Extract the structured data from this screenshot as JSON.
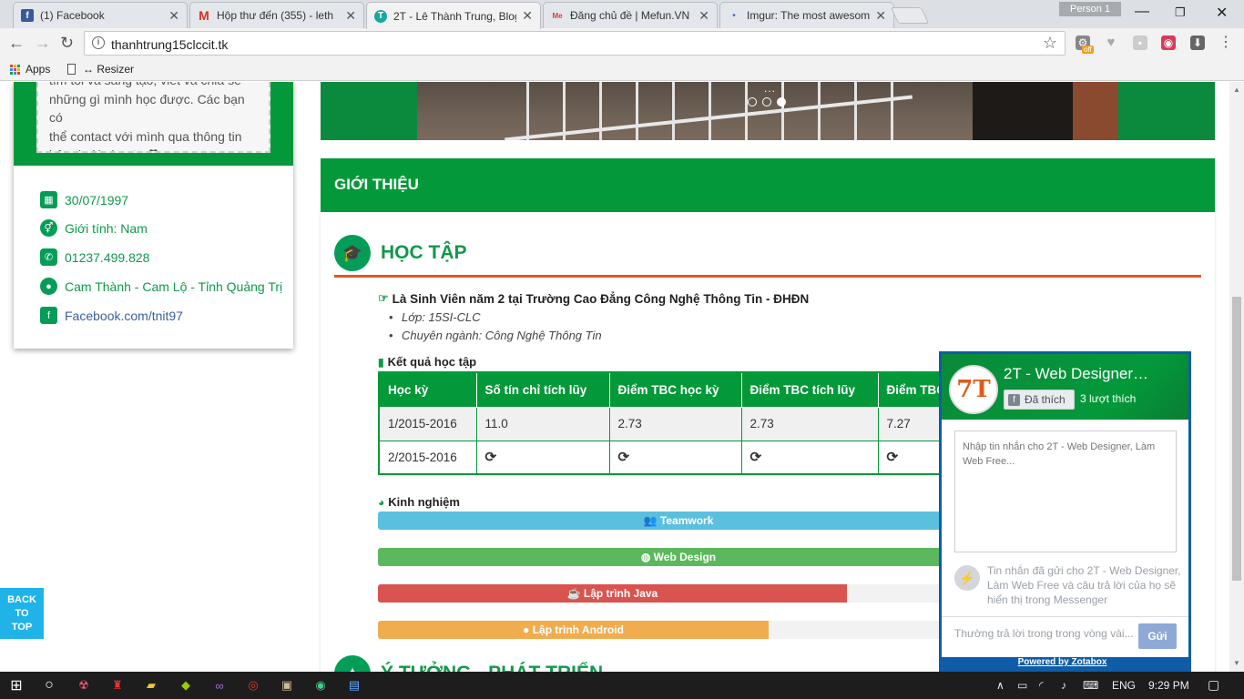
{
  "browser": {
    "tabs": [
      {
        "title": "(1) Facebook",
        "favicon": "facebook-icon",
        "color": "#3b5998"
      },
      {
        "title": "Hộp thư đến (355) - leth",
        "favicon": "gmail-icon",
        "color": "#d93025"
      },
      {
        "title": "2T - Lê Thành Trung, Blog",
        "favicon": "2t-site-icon",
        "color": "#1aa89e"
      },
      {
        "title": "Đăng chủ đề | Mefun.VN",
        "favicon": "mefun-icon",
        "color": "#e53935"
      },
      {
        "title": "Imgur: The most awesom",
        "favicon": "imgur-icon",
        "color": "#4a6fd0"
      }
    ],
    "person_label": "Person 1",
    "url": "thanhtrung15clccit.tk",
    "ext_badge": "off",
    "bookmarks": [
      {
        "label": "Apps"
      },
      {
        "label": "↔ Resizer"
      }
    ]
  },
  "sidebar": {
    "quote_lines": [
      "tìm tòi và sáng tạo, viết và chia sẻ",
      "những gì mình học được. Các bạn có",
      "thể contact với mình qua thông tin",
      "bên dưới nha 🗪 ❞"
    ],
    "contacts": [
      {
        "icon": "calendar-icon",
        "text": "30/07/1997"
      },
      {
        "icon": "gender-icon",
        "text": "Giới tính: Nam"
      },
      {
        "icon": "phone-icon",
        "text": "01237.499.828"
      },
      {
        "icon": "map-marker-icon",
        "text": "Cam Thành - Cam Lộ - Tỉnh Quảng Trị"
      },
      {
        "icon": "facebook-icon",
        "text": "Facebook.com/tnit97"
      }
    ]
  },
  "slider": {
    "active_dot": 3,
    "dot_count": 3,
    "ellipsis": "..."
  },
  "section": {
    "title": "GIỚI THIỆU",
    "hoc_tap": {
      "title": "HỌC TẬP",
      "headline": "Là Sinh Viên năm 2 tại Trường Cao Đẳng Công Nghệ Thông Tin - ĐHĐN",
      "bullets": [
        "Lớp: 15SI-CLC",
        "Chuyên ngành: Công Nghệ Thông Tin"
      ],
      "results_title": "Kết quả học tập",
      "table": {
        "headers": [
          "Học kỳ",
          "Số tín chỉ tích lũy",
          "Điểm TBC học kỳ",
          "Điểm TBC tích lũy",
          "Điểm TBC"
        ],
        "rows": [
          [
            "1/2015-2016",
            "11.0",
            "2.73",
            "2.73",
            "7.27"
          ],
          [
            "2/2015-2016",
            "⟳",
            "⟳",
            "⟳",
            "⟳"
          ]
        ]
      },
      "experience_title": "Kinh nghiệm",
      "skills": [
        {
          "label": "Teamwork",
          "icon": "users-icon",
          "level": 100,
          "color": "#5bc0de"
        },
        {
          "label": "Web Design",
          "icon": "globe-icon",
          "level": 100,
          "color": "#5cb85c"
        },
        {
          "label": "Lập trình Java",
          "icon": "java-icon",
          "level": 78,
          "color": "#d9534f"
        },
        {
          "label": "Lập trình Android",
          "icon": "android-icon",
          "level": 65,
          "color": "#f0ad4e"
        }
      ]
    },
    "next_title": "Ý TƯỞNG - PHÁT TRIỂN"
  },
  "zotabox": {
    "page_name": "2T - Web Designer…",
    "like_label": "Đã thích",
    "likes": "3 lượt thích",
    "placeholder": "Nhập tin nhắn cho 2T - Web Designer, Làm Web Free...",
    "note": "Tin nhắn đã gửi cho 2T - Web Designer, Làm Web Free và câu trả lời của họ sẽ hiển thị trong Messenger",
    "reply_time": "Thường trả lời trong trong vòng vài...",
    "send": "Gửi",
    "powered": "Powered by Zotabox"
  },
  "back_to_top": [
    "BACK",
    "TO",
    "TOP"
  ],
  "taskbar": {
    "lang": "ENG",
    "time": "9:29 PM"
  }
}
